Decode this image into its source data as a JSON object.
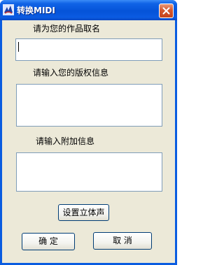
{
  "window": {
    "title": "转换MIDI"
  },
  "colors": {
    "titlebar": "#0a5ce0",
    "client_bg": "#ece9d8",
    "close_button": "#d5582e",
    "field_border": "#7f9db9"
  },
  "icons": {
    "app": "app-icon",
    "close": "close-icon"
  },
  "form": {
    "title_label": "请为您的作品取名",
    "title_value": "",
    "copyright_label": "请输入您的版权信息",
    "copyright_value": "",
    "extra_label": "请输入附加信息",
    "extra_value": ""
  },
  "buttons": {
    "stereo": "设置立体声",
    "ok": "确 定",
    "cancel": "取 消"
  }
}
